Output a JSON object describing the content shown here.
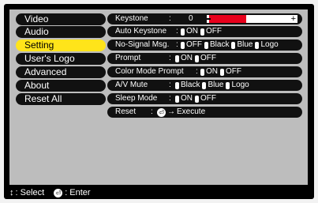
{
  "sidebar": {
    "items": [
      {
        "label": "Video",
        "active": false
      },
      {
        "label": "Audio",
        "active": false
      },
      {
        "label": "Setting",
        "active": true
      },
      {
        "label": "User's Logo",
        "active": false
      },
      {
        "label": "Advanced",
        "active": false
      },
      {
        "label": "About",
        "active": false
      },
      {
        "label": "Reset All",
        "active": false
      }
    ]
  },
  "settings": {
    "keystone": {
      "label": "Keystone",
      "sep": ":",
      "value": "0",
      "minus": "−",
      "plus": "+",
      "level": 0.5
    },
    "auto_keystone": {
      "label": "Auto Keystone",
      "sep": ":",
      "options": [
        "ON",
        "OFF"
      ]
    },
    "no_signal": {
      "label": "No-Signal Msg.",
      "sep": ":",
      "options": [
        "OFF",
        "Black",
        "Blue",
        "Logo"
      ]
    },
    "prompt": {
      "label": "Prompt",
      "sep": ":",
      "options": [
        "ON",
        "OFF"
      ]
    },
    "color_mode_prompt": {
      "label": "Color Mode Prompt",
      "sep": ":",
      "options": [
        "ON",
        "OFF"
      ]
    },
    "av_mute": {
      "label": "A/V Mute",
      "sep": ":",
      "options": [
        "Black",
        "Blue",
        "Logo"
      ]
    },
    "sleep_mode": {
      "label": "Sleep Mode",
      "sep": ":",
      "options": [
        "ON",
        "OFF"
      ]
    },
    "reset": {
      "label": "Reset",
      "sep": ":",
      "arrow": "→",
      "action": "Execute"
    }
  },
  "status_bar": {
    "select_icon": "↕",
    "select_label": ": Select",
    "enter_label": ": Enter"
  },
  "icons": {
    "select": "up-down-arrows-icon",
    "enter": "enter-button-icon"
  },
  "colors": {
    "accent": "#ffe41a",
    "bar": "#e8001c",
    "panel": "#bdbdbd"
  }
}
